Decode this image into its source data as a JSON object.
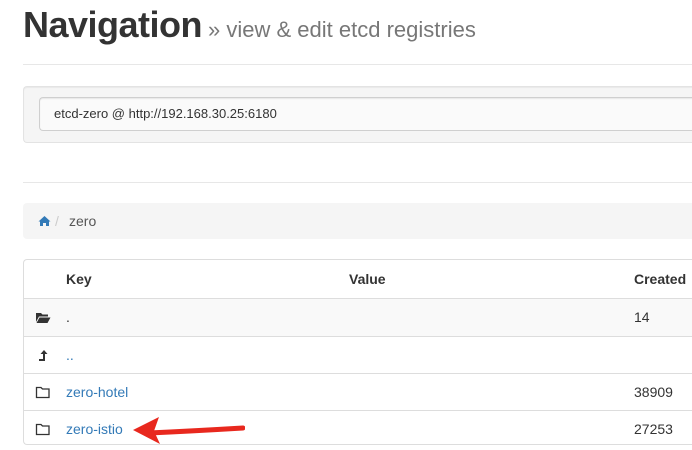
{
  "header": {
    "title": "Navigation",
    "subtitle": "» view & edit etcd registries"
  },
  "registry_select": {
    "value": "etcd-zero @ http://192.168.30.25:6180"
  },
  "breadcrumb": {
    "current": "zero",
    "separator": "/"
  },
  "table": {
    "headers": {
      "key": "Key",
      "value": "Value",
      "created": "Created"
    },
    "rows": [
      {
        "icon": "folder-open-icon",
        "key": ".",
        "value": "",
        "created": "14"
      },
      {
        "icon": "level-up-icon",
        "key": "..",
        "value": "",
        "created": ""
      },
      {
        "icon": "folder-icon",
        "key": "zero-hotel",
        "value": "",
        "created": "38909"
      },
      {
        "icon": "folder-icon",
        "key": "zero-istio",
        "value": "",
        "created": "27253"
      }
    ]
  },
  "colors": {
    "link": "#337ab7",
    "annotation_arrow": "#e8281e"
  }
}
